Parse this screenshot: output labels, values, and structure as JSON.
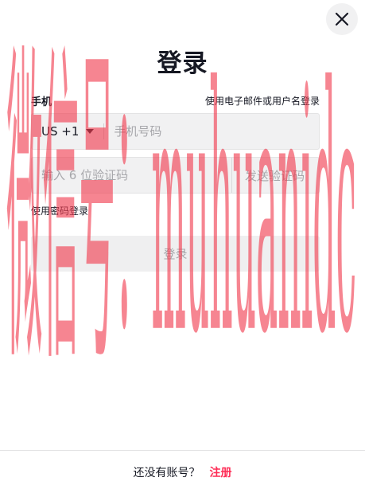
{
  "header": {
    "title": "登录",
    "close_icon": "close-icon"
  },
  "form": {
    "phone_label": "手机",
    "switch_method_link": "使用电子邮件或用户名登录",
    "country_code": "US +1",
    "phone_placeholder": "手机号码",
    "code_placeholder": "输入 6 位验证码",
    "send_code_label": "发送验证码",
    "password_login_link": "使用密码登录",
    "submit_label": "登录"
  },
  "footer": {
    "prompt": "还没有账号？",
    "signup_link": "注册"
  },
  "watermark": {
    "text": "微信号：muhuanidc"
  },
  "colors": {
    "primary_text": "#161823",
    "accent": "#fe2c55",
    "input_bg": "#f1f1f2",
    "disabled_text": "#a7a7ab",
    "watermark": "#f23b4e"
  }
}
